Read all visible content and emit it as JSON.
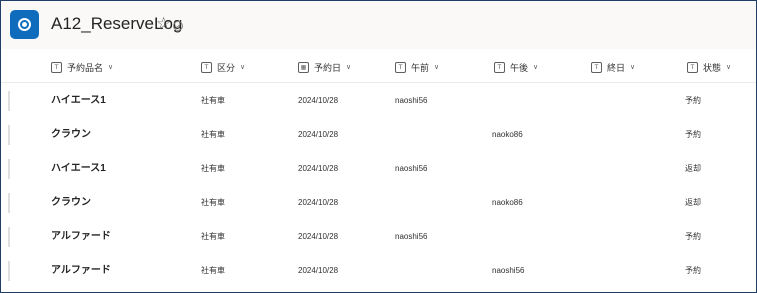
{
  "app": {
    "title": "A12_ReserveLog",
    "icon": "list-app-icon"
  },
  "header_icons": [
    "star-icon",
    "verified-icon"
  ],
  "columns": [
    {
      "label": "予約品名",
      "icon": "text-icon",
      "type_glyph": "T"
    },
    {
      "label": "区分",
      "icon": "text-icon",
      "type_glyph": "T"
    },
    {
      "label": "予約日",
      "icon": "calendar-icon",
      "type_glyph": "▦"
    },
    {
      "label": "午前",
      "icon": "text-icon",
      "type_glyph": "T"
    },
    {
      "label": "午後",
      "icon": "text-icon",
      "type_glyph": "T"
    },
    {
      "label": "終日",
      "icon": "text-icon",
      "type_glyph": "T"
    },
    {
      "label": "状態",
      "icon": "text-icon",
      "type_glyph": "T"
    }
  ],
  "rows": [
    {
      "name": "ハイエース1",
      "category": "社有車",
      "date": "2024/10/28",
      "am": "naoshi56",
      "pm": "",
      "allday": "",
      "status": "予約"
    },
    {
      "name": "クラウン",
      "category": "社有車",
      "date": "2024/10/28",
      "am": "",
      "pm": "naoko86",
      "allday": "",
      "status": "予約"
    },
    {
      "name": "ハイエース1",
      "category": "社有車",
      "date": "2024/10/28",
      "am": "naoshi56",
      "pm": "",
      "allday": "",
      "status": "返却"
    },
    {
      "name": "クラウン",
      "category": "社有車",
      "date": "2024/10/28",
      "am": "",
      "pm": "naoko86",
      "allday": "",
      "status": "返却"
    },
    {
      "name": "アルファード",
      "category": "社有車",
      "date": "2024/10/28",
      "am": "naoshi56",
      "pm": "",
      "allday": "",
      "status": "予約"
    },
    {
      "name": "アルファード",
      "category": "社有車",
      "date": "2024/10/28",
      "am": "",
      "pm": "naoshi56",
      "allday": "",
      "status": "予約"
    }
  ],
  "colors": {
    "brand": "#0f6cbd",
    "border": "#1f3f66",
    "header_bg": "#faf9f8"
  }
}
